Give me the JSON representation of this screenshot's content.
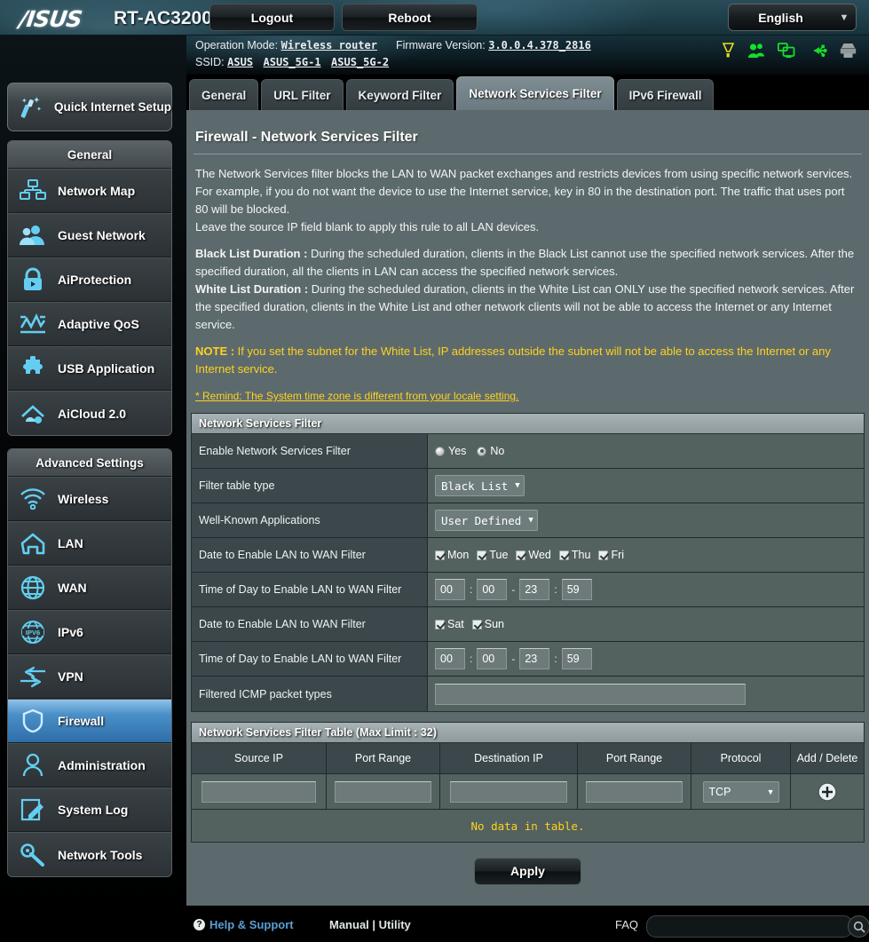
{
  "header": {
    "brand": "/ISUS",
    "model": "RT-AC3200",
    "logout_label": "Logout",
    "reboot_label": "Reboot",
    "language": "English",
    "status_icons": [
      "alert-icon",
      "guest-network-icon",
      "client-list-icon",
      "usb-icon",
      "printer-icon"
    ]
  },
  "info": {
    "operation_mode_label": "Operation Mode:",
    "operation_mode_value": "Wireless router",
    "firmware_label": "Firmware Version:",
    "firmware_value": "3.0.0.4.378_2816",
    "ssid_label": "SSID:",
    "ssids": [
      "ASUS",
      "ASUS_5G-1",
      "ASUS_5G-2"
    ]
  },
  "sidebar": {
    "quick_setup_label": "Quick Internet Setup",
    "groups": [
      {
        "title": "General",
        "items": [
          {
            "label": "Network Map",
            "icon": "network-map-icon",
            "active": false
          },
          {
            "label": "Guest Network",
            "icon": "guest-network-icon",
            "active": false
          },
          {
            "label": "AiProtection",
            "icon": "lock-shield-icon",
            "active": false
          },
          {
            "label": "Adaptive QoS",
            "icon": "qos-chart-icon",
            "active": false
          },
          {
            "label": "USB Application",
            "icon": "puzzle-icon",
            "active": false
          },
          {
            "label": "AiCloud 2.0",
            "icon": "cloud-house-icon",
            "active": false
          }
        ]
      },
      {
        "title": "Advanced Settings",
        "items": [
          {
            "label": "Wireless",
            "icon": "wifi-icon",
            "active": false
          },
          {
            "label": "LAN",
            "icon": "house-icon",
            "active": false
          },
          {
            "label": "WAN",
            "icon": "globe-icon",
            "active": false
          },
          {
            "label": "IPv6",
            "icon": "ipv6-globe-icon",
            "active": false
          },
          {
            "label": "VPN",
            "icon": "vpn-arrows-icon",
            "active": false
          },
          {
            "label": "Firewall",
            "icon": "shield-icon",
            "active": true
          },
          {
            "label": "Administration",
            "icon": "user-icon",
            "active": false
          },
          {
            "label": "System Log",
            "icon": "pencil-note-icon",
            "active": false
          },
          {
            "label": "Network Tools",
            "icon": "wrench-icon",
            "active": false
          }
        ]
      }
    ]
  },
  "tabs": [
    {
      "label": "General",
      "active": false
    },
    {
      "label": "URL Filter",
      "active": false
    },
    {
      "label": "Keyword Filter",
      "active": false
    },
    {
      "label": "Network Services Filter",
      "active": true
    },
    {
      "label": "IPv6 Firewall",
      "active": false
    }
  ],
  "page": {
    "title": "Firewall - Network Services Filter",
    "desc_p1": "The Network Services filter blocks the LAN to WAN packet exchanges and restricts devices from using specific network services.",
    "desc_p2": "For example, if you do not want the device to use the Internet service, key in 80 in the destination port. The traffic that uses port 80 will be blocked.",
    "desc_p3": "Leave the source IP field blank to apply this rule to all LAN devices.",
    "black_list_label": "Black List Duration :",
    "black_list_text": " During the scheduled duration, clients in the Black List cannot use the specified network services. After the specified duration, all the clients in LAN can access the specified network services.",
    "white_list_label": "White List Duration :",
    "white_list_text": " During the scheduled duration, clients in the White List can ONLY use the specified network services. After the specified duration, clients in the White List and other network clients will not be able to access the Internet or any Internet service.",
    "note_label": "NOTE :",
    "note_text": " If you set the subnet for the White List, IP addresses outside the subnet will not be able to access the Internet or any Internet service.",
    "remind": "* Remind: The System time zone is different from your locale setting."
  },
  "form": {
    "section_title": "Network Services Filter",
    "enable_label": "Enable Network Services Filter",
    "radio_yes": "Yes",
    "radio_no": "No",
    "enable_selected": "No",
    "filter_table_type_label": "Filter table type",
    "filter_table_type_value": "Black List",
    "well_known_label": "Well-Known Applications",
    "well_known_value": "User Defined",
    "date_label_weekday": "Date to Enable LAN to WAN Filter",
    "weekdays": [
      {
        "label": "Mon",
        "checked": true
      },
      {
        "label": "Tue",
        "checked": true
      },
      {
        "label": "Wed",
        "checked": true
      },
      {
        "label": "Thu",
        "checked": true
      },
      {
        "label": "Fri",
        "checked": true
      }
    ],
    "time_label_weekday": "Time of Day to Enable LAN to WAN Filter",
    "weekday_time": {
      "start_h": "00",
      "start_m": "00",
      "end_h": "23",
      "end_m": "59"
    },
    "date_label_weekend": "Date to Enable LAN to WAN Filter",
    "weekend": [
      {
        "label": "Sat",
        "checked": true
      },
      {
        "label": "Sun",
        "checked": true
      }
    ],
    "time_label_weekend": "Time of Day to Enable LAN to WAN Filter",
    "weekend_time": {
      "start_h": "00",
      "start_m": "00",
      "end_h": "23",
      "end_m": "59"
    },
    "icmp_label": "Filtered ICMP packet types",
    "icmp_value": ""
  },
  "filter_table": {
    "section_title": "Network Services Filter Table (Max Limit : 32)",
    "columns": [
      "Source IP",
      "Port Range",
      "Destination IP",
      "Port Range",
      "Protocol",
      "Add / Delete"
    ],
    "new_row": {
      "source_ip": "",
      "source_port_range": "",
      "destination_ip": "",
      "destination_port_range": "",
      "protocol": "TCP"
    },
    "empty_message": "No data in table.",
    "add_icon": "plus-circle-icon"
  },
  "apply_label": "Apply",
  "footer": {
    "help_label": "Help & Support",
    "manual_label": "Manual | Utility",
    "faq_label": "FAQ",
    "search_value": "",
    "search_icon": "magnifier-icon"
  }
}
